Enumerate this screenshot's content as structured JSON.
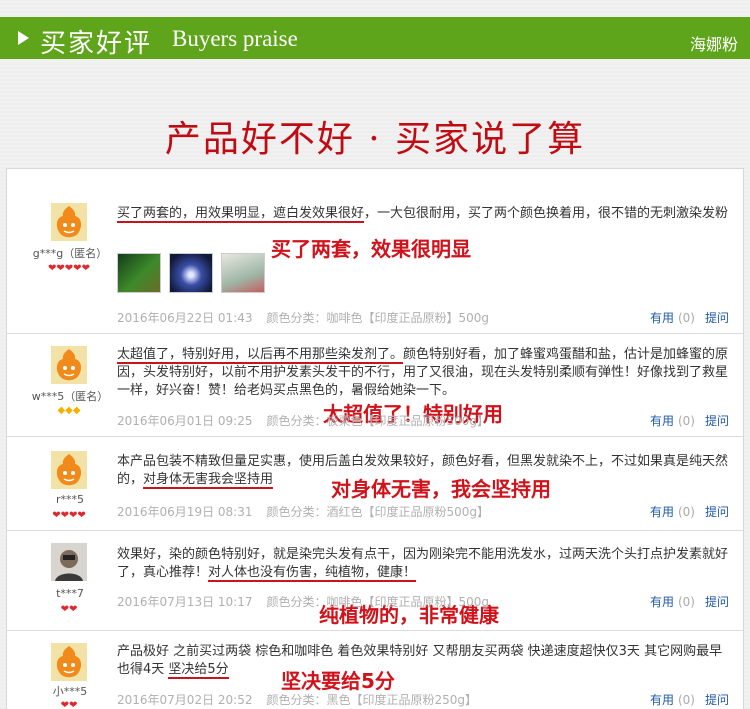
{
  "banner": {
    "title_cn": "买家好评",
    "title_en": "Buyers praise",
    "brand": "海娜粉"
  },
  "headline": "产品好不好 · 买家说了算",
  "colors": {
    "banner_green": "#5fa51b",
    "accent_red": "#c00b12",
    "link_blue": "#1f5aa6"
  },
  "reviews": [
    {
      "user": "g***g（匿名）",
      "level": "❤❤❤❤❤",
      "text_ul1": "买了两套的，用效果明显，遮白发效果很好",
      "text_rest": "，一大包很耐用，买了两个颜色换着用，很不错的无刺激染发粉",
      "highlight": "买了两套，效果很明显",
      "date": "2016年06月22日 01:43",
      "spec": "颜色分类：咖啡色【印度正品原粉】500g",
      "useful_label": "有用",
      "useful_count": "(0)",
      "ask_label": "提问"
    },
    {
      "user": "w***5（匿名）",
      "level": "◆◆◆",
      "text_ul1": "太超值了，特别好用，以后再不用那些染发剂了。",
      "text_rest": "颜色特别好看，加了蜂蜜鸡蛋醋和盐，估计是加蜂蜜的原因，头发特别好，以前不用护发素头发干的不行，用了又很油，现在头发特别柔顺有弹性！好像找到了救星一样，好兴奋！赞！给老妈买点黑色的，暑假给她染一下。",
      "highlight": "太超值了！特别好用",
      "date": "2016年06月01日 09:25",
      "spec": "颜色分类：板栗色【印度正品原粉500g】",
      "useful_label": "有用",
      "useful_count": "(0)",
      "ask_label": "提问"
    },
    {
      "user": "r***5",
      "level": "❤❤❤❤",
      "text_pre": "本产品包装不精致但量足实惠，使用后盖白发效果较好，颜色好看，但黑发就染不上，不过如果真是纯天然的，",
      "text_ul1": "对身体无害我会坚持用",
      "highlight": "对身体无害，我会坚持用",
      "date": "2016年06月19日 08:31",
      "spec": "颜色分类：酒红色【印度正品原粉500g】",
      "useful_label": "有用",
      "useful_count": "(0)",
      "ask_label": "提问"
    },
    {
      "user": "t***7",
      "level": "❤❤",
      "text_pre": "效果好，染的颜色特别好，就是染完头发有点干，因为刚染完不能用洗发水，过两天洗个头打点护发素就好了，真心推荐！",
      "text_ul1": "对人体也没有伤害，纯植物，健康！",
      "highlight": "纯植物的，非常健康",
      "date": "2016年07月13日 10:17",
      "spec": "颜色分类：咖啡色【印度正品原粉】500g",
      "useful_label": "有用",
      "useful_count": "(0)",
      "ask_label": "提问"
    },
    {
      "user": "小***5",
      "level": "❤❤",
      "text_pre": "产品极好 之前买过两袋 棕色和咖啡色 着色效果特别好 又帮朋友买两袋 快递速度超快仅3天 其它网购最早也得4天 ",
      "text_ul1": "坚决给5分",
      "highlight": "坚决要给5分",
      "date": "2016年07月02日 20:52",
      "spec": "颜色分类：黑色【印度正品原粉250g】",
      "useful_label": "有用",
      "useful_count": "(0)",
      "ask_label": "提问"
    }
  ]
}
